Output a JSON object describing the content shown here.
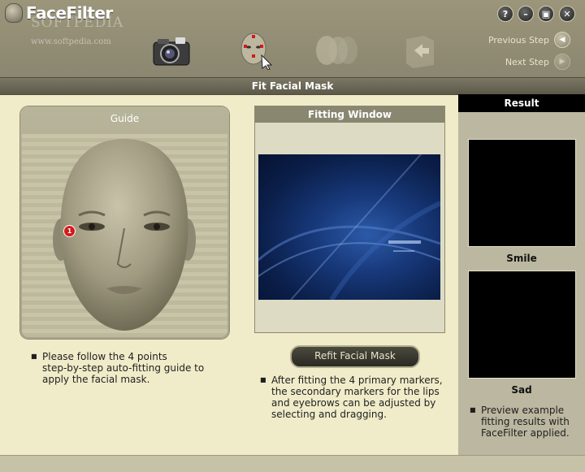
{
  "app": {
    "logo_word1": "Face",
    "logo_word2": "Filter",
    "watermark": "SOFTPEDIA",
    "watermark_url": "www.softpedia.com"
  },
  "window_controls": [
    {
      "name": "help-button",
      "glyph": "?"
    },
    {
      "name": "minimize-button",
      "glyph": "–"
    },
    {
      "name": "restore-button",
      "glyph": "▣"
    },
    {
      "name": "close-button",
      "glyph": "✕"
    }
  ],
  "navigation": {
    "previous_label": "Previous Step",
    "next_label": "Next Step",
    "previous_icon": "chevron-left-icon",
    "next_icon": "chevron-right-icon"
  },
  "steps": [
    {
      "name": "camera-step-icon"
    },
    {
      "name": "face-mask-step-icon"
    },
    {
      "name": "expressions-step-icon"
    },
    {
      "name": "save-step-icon"
    }
  ],
  "page_title": "Fit Facial Mask",
  "guide": {
    "title": "Guide",
    "marker_number": "1",
    "instruction": "Please follow the 4 points\nstep-by-step auto-fitting guide to\napply the facial mask."
  },
  "fitting": {
    "title": "Fitting Window",
    "refit_label": "Refit Facial Mask",
    "instruction": "After fitting the 4 primary markers,\nthe secondary markers for the lips\nand eyebrows can be adjusted by\nselecting and dragging."
  },
  "result": {
    "header": "Result",
    "smile_label": "Smile",
    "sad_label": "Sad",
    "note": "Preview example\nfitting results with\nFaceFilter applied."
  },
  "colors": {
    "header_bg": "#8f8a73",
    "body_bg": "#f0ecc9",
    "marker": "#d41a1a"
  }
}
